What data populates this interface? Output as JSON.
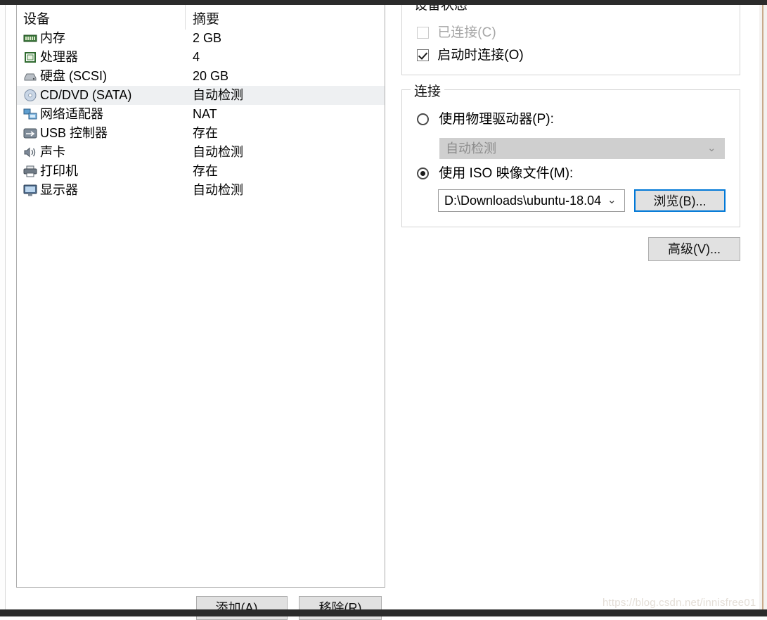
{
  "device_list": {
    "headers": {
      "device": "设备",
      "summary": "摘要"
    },
    "rows": [
      {
        "icon": "memory-icon",
        "name": "内存",
        "summary": "2 GB",
        "selected": false
      },
      {
        "icon": "cpu-icon",
        "name": "处理器",
        "summary": "4",
        "selected": false
      },
      {
        "icon": "harddisk-icon",
        "name": "硬盘 (SCSI)",
        "summary": "20 GB",
        "selected": false
      },
      {
        "icon": "cddvd-icon",
        "name": "CD/DVD (SATA)",
        "summary": "自动检测",
        "selected": true
      },
      {
        "icon": "network-icon",
        "name": "网络适配器",
        "summary": "NAT",
        "selected": false
      },
      {
        "icon": "usb-icon",
        "name": "USB 控制器",
        "summary": "存在",
        "selected": false
      },
      {
        "icon": "sound-icon",
        "name": "声卡",
        "summary": "自动检测",
        "selected": false
      },
      {
        "icon": "printer-icon",
        "name": "打印机",
        "summary": "存在",
        "selected": false
      },
      {
        "icon": "display-icon",
        "name": "显示器",
        "summary": "自动检测",
        "selected": false
      }
    ],
    "add_button": "添加(A)...",
    "remove_button": "移除(R)"
  },
  "device_status": {
    "legend": "设备状态",
    "connected_label": "已连接(C)",
    "connected_checked": false,
    "connected_enabled": false,
    "connect_at_power_on_label": "启动时连接(O)",
    "connect_at_power_on_checked": true
  },
  "connection": {
    "legend": "连接",
    "use_physical_drive_label": "使用物理驱动器(P):",
    "use_physical_drive_selected": false,
    "physical_drive_value": "自动检测",
    "physical_drive_enabled": false,
    "use_iso_label": "使用 ISO 映像文件(M):",
    "use_iso_selected": true,
    "iso_path_value": "D:\\Downloads\\ubuntu-18.04",
    "browse_button": "浏览(B)...",
    "advanced_button": "高级(V)...",
    "caret_glyph": "⌄",
    "focus_color": "#0078d7"
  },
  "watermark": {
    "text": "https://blog.csdn.net/innisfree01"
  }
}
